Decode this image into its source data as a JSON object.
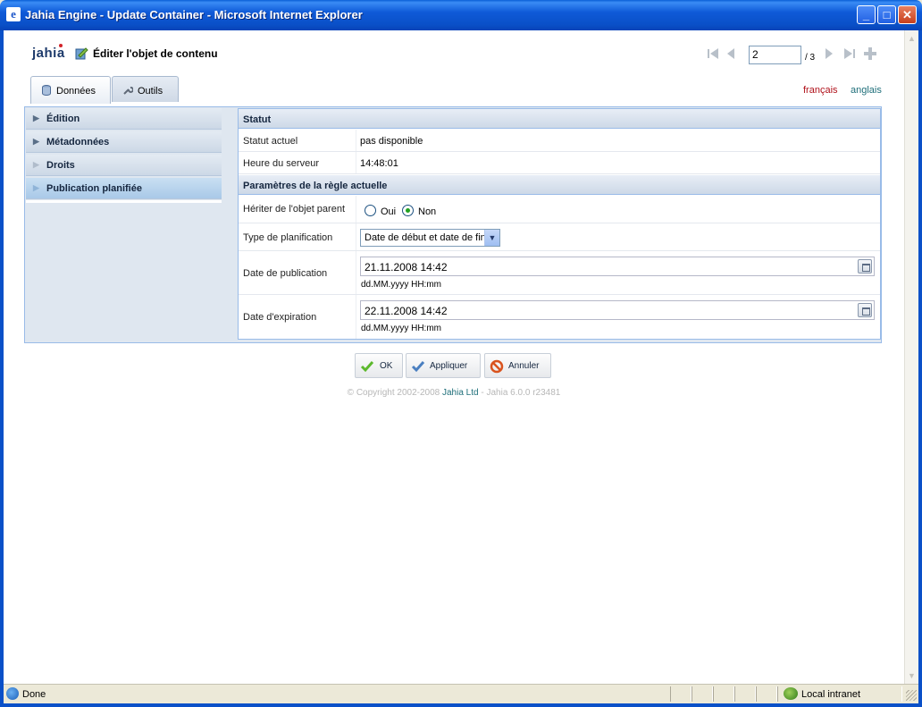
{
  "window": {
    "title": "Jahia Engine - Update Container - Microsoft Internet Explorer",
    "minimize_label": "_",
    "maximize_label": "□",
    "close_label": "✕"
  },
  "header": {
    "logo_text": "jahia",
    "title": "Éditer l'objet de contenu",
    "page_current": "2",
    "page_total": "/ 3"
  },
  "tabs": [
    {
      "label": "Données",
      "active": true,
      "icon": "database-icon"
    },
    {
      "label": "Outils",
      "active": false,
      "icon": "wrench-icon"
    }
  ],
  "languages": [
    "français",
    "anglais"
  ],
  "sidebar": {
    "items": [
      {
        "label": "Édition"
      },
      {
        "label": "Métadonnées"
      },
      {
        "label": "Droits"
      },
      {
        "label": "Publication planifiée",
        "active": true
      }
    ]
  },
  "status_section": {
    "title": "Statut",
    "rows": [
      {
        "label": "Statut actuel",
        "value": "pas disponible"
      },
      {
        "label": "Heure du serveur",
        "value": "14:48:01"
      }
    ]
  },
  "rule_section": {
    "title": "Paramètres de la règle actuelle",
    "inherit": {
      "label": "Hériter de l'objet parent",
      "option_yes": "Oui",
      "option_no": "Non",
      "selected": "Non"
    },
    "schedule_type": {
      "label": "Type de planification",
      "value": "Date de début et date de fin"
    },
    "publication_date": {
      "label": "Date de publication",
      "value": "21.11.2008 14:42",
      "format": "dd.MM.yyyy HH:mm"
    },
    "expiration_date": {
      "label": "Date d'expiration",
      "value": "22.11.2008 14:42",
      "format": "dd.MM.yyyy HH:mm"
    }
  },
  "buttons": {
    "ok": "OK",
    "apply": "Appliquer",
    "cancel": "Annuler"
  },
  "footer": {
    "copyright_prefix": "© Copyright 2002-2008",
    "company": "Jahia Ltd",
    "version": "- Jahia 6.0.0 r23481"
  },
  "statusbar": {
    "text": "Done",
    "zone": "Local intranet"
  },
  "colors": {
    "accent": "#0a50c8",
    "link_fr": "#b0121b",
    "link_en": "#1f6f7a",
    "panel_border": "#99bbe8"
  }
}
